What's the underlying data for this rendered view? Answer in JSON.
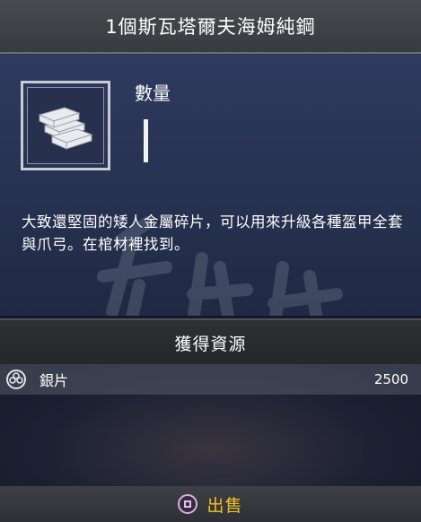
{
  "title": "1個斯瓦塔爾夫海姆純鋼",
  "item": {
    "icon": "steel-ingots-icon",
    "quantity_label": "數量",
    "description": "大致還堅固的矮人金屬碎片，可以用來升級各種盔甲全套與爪弓。在棺材裡找到。"
  },
  "sources": {
    "header": "獲得資源",
    "resources": [
      {
        "icon": "hacksilver-icon",
        "name": "銀片",
        "value": "2500"
      }
    ]
  },
  "footer": {
    "button_icon": "square-button-icon",
    "sell_label": "出售",
    "accent_color": "#f0c520"
  }
}
